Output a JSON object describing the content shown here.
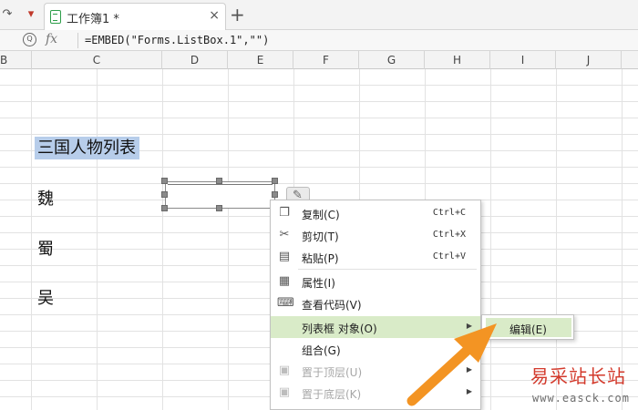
{
  "tabbar": {
    "undo_icon": "redo-icon",
    "tab_title": "工作簿1 *",
    "tab_close": "×",
    "new_tab": "+"
  },
  "formula_bar": {
    "fx_label": "fx",
    "formula": "=EMBED(\"Forms.ListBox.1\",\"\")"
  },
  "columns": [
    "B",
    "C",
    "D",
    "E",
    "F",
    "G",
    "H",
    "I",
    "J"
  ],
  "cells": {
    "title": "三国人物列表",
    "wei": "魏",
    "shu": "蜀",
    "wu": "吴"
  },
  "highlight_color": "#b7cdea",
  "context_menu": {
    "items": [
      {
        "label": "复制(C)",
        "shortcut": "Ctrl+C",
        "icon": "copy-icon"
      },
      {
        "label": "剪切(T)",
        "shortcut": "Ctrl+X",
        "icon": "scissors-icon"
      },
      {
        "label": "粘贴(P)",
        "shortcut": "Ctrl+V",
        "icon": "paste-icon"
      },
      {
        "label": "属性(I)",
        "icon": "properties-icon"
      },
      {
        "label": "查看代码(V)",
        "icon": "view-code-icon"
      },
      {
        "label": "列表框 对象(O)",
        "icon": "",
        "submenu": true
      },
      {
        "label": "组合(G)",
        "icon": ""
      },
      {
        "label": "置于顶层(U)",
        "icon": "bring-front-icon",
        "disabled": true
      },
      {
        "label": "置于底层(K)",
        "icon": "send-back-icon",
        "disabled": true
      }
    ]
  },
  "submenu": {
    "edit_label": "编辑(E)"
  },
  "active_color": "#d9ebc8",
  "arrow_color": "#f39423",
  "watermark": {
    "title": "易采站长站",
    "url": "www.easck.com"
  }
}
